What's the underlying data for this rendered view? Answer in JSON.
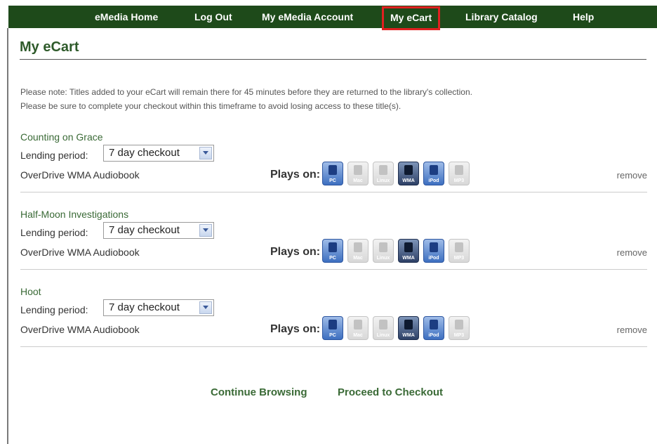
{
  "nav": {
    "items": [
      {
        "label": "eMedia Home"
      },
      {
        "label": "Log Out"
      },
      {
        "label": "My eMedia Account"
      },
      {
        "label": "My eCart"
      },
      {
        "label": "Library Catalog"
      },
      {
        "label": "Help"
      }
    ],
    "active": "My eCart"
  },
  "page": {
    "title": "My eCart",
    "note_line1": "Please note: Titles added to your eCart will remain there for 45 minutes before they are returned to the library's collection.",
    "note_line2": "Please be sure to complete your checkout within this timeframe to avoid losing access to these title(s)."
  },
  "cart": {
    "lending_label": "Lending period:",
    "plays_on_label": "Plays on:",
    "remove_label": "remove",
    "devices": [
      {
        "tag": "PC",
        "icon": "pc-icon",
        "supported": true
      },
      {
        "tag": "Mac",
        "icon": "mac-icon",
        "supported": false
      },
      {
        "tag": "Linux",
        "icon": "linux-icon",
        "supported": false
      },
      {
        "tag": "WMA",
        "icon": "wma-player-icon",
        "supported": true
      },
      {
        "tag": "iPod",
        "icon": "ipod-icon",
        "supported": true
      },
      {
        "tag": "MP3",
        "icon": "mp3-player-icon",
        "supported": false
      }
    ],
    "items": [
      {
        "title": "Counting on Grace",
        "lending_period": "7 day checkout",
        "format": "OverDrive WMA Audiobook"
      },
      {
        "title": "Half-Moon Investigations",
        "lending_period": "7 day checkout",
        "format": "OverDrive WMA Audiobook"
      },
      {
        "title": "Hoot",
        "lending_period": "7 day checkout",
        "format": "OverDrive WMA Audiobook"
      }
    ]
  },
  "actions": {
    "continue_label": "Continue Browsing",
    "checkout_label": "Proceed to Checkout"
  },
  "colors": {
    "nav_bg": "#1e4a1a",
    "title_green": "#2e5a2a",
    "link_green": "#3a6a36",
    "active_highlight": "#e02020"
  }
}
